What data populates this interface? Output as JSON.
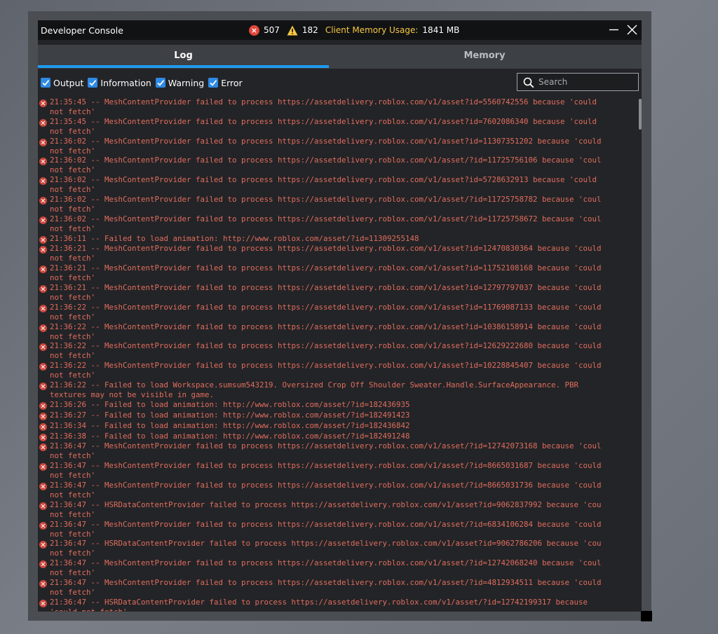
{
  "window": {
    "title": "Developer Console",
    "error_count": "507",
    "warning_count": "182",
    "memory_label": "Client Memory Usage:",
    "memory_value": "1841 MB"
  },
  "tabs": [
    {
      "label": "Log",
      "active": true
    },
    {
      "label": "Memory",
      "active": false
    }
  ],
  "filters": [
    {
      "label": "Output",
      "checked": true
    },
    {
      "label": "Information",
      "checked": true
    },
    {
      "label": "Warning",
      "checked": true
    },
    {
      "label": "Error",
      "checked": true
    }
  ],
  "search": {
    "placeholder": "Search"
  },
  "colors": {
    "error_text": "#e06d5e",
    "accent": "#1e9bf0",
    "memory_label": "#f5c842"
  },
  "log": [
    {
      "line1": "21:35:45 -- MeshContentProvider failed to process https://assetdelivery.roblox.com/v1/asset?id=5560742556 because 'could",
      "line2": "not fetch'"
    },
    {
      "line1": "21:35:45 -- MeshContentProvider failed to process https://assetdelivery.roblox.com/v1/asset?id=7602086340 because 'could",
      "line2": "not fetch'"
    },
    {
      "line1": "21:36:02 -- MeshContentProvider failed to process https://assetdelivery.roblox.com/v1/asset?id=11307351202 because 'could",
      "line2": "not fetch'"
    },
    {
      "line1": "21:36:02 -- MeshContentProvider failed to process https://assetdelivery.roblox.com/v1/asset/?id=11725756106 because 'coul",
      "line2": "not fetch'"
    },
    {
      "line1": "21:36:02 -- MeshContentProvider failed to process https://assetdelivery.roblox.com/v1/asset?id=5728632913 because 'could",
      "line2": "not fetch'"
    },
    {
      "line1": "21:36:02 -- MeshContentProvider failed to process https://assetdelivery.roblox.com/v1/asset/?id=11725758782 because 'coul",
      "line2": "not fetch'"
    },
    {
      "line1": "21:36:02 -- MeshContentProvider failed to process https://assetdelivery.roblox.com/v1/asset/?id=11725758672 because 'coul",
      "line2": "not fetch'"
    },
    {
      "line1": "21:36:11 -- Failed to load animation: http://www.roblox.com/asset/?id=11309255148"
    },
    {
      "line1": "21:36:21 -- MeshContentProvider failed to process https://assetdelivery.roblox.com/v1/asset?id=12470830364 because 'could",
      "line2": "not fetch'"
    },
    {
      "line1": "21:36:21 -- MeshContentProvider failed to process https://assetdelivery.roblox.com/v1/asset?id=11752108168 because 'could",
      "line2": "not fetch'"
    },
    {
      "line1": "21:36:21 -- MeshContentProvider failed to process https://assetdelivery.roblox.com/v1/asset?id=12797797037 because 'could",
      "line2": "not fetch'"
    },
    {
      "line1": "21:36:22 -- MeshContentProvider failed to process https://assetdelivery.roblox.com/v1/asset?id=11769087133 because 'could",
      "line2": "not fetch'"
    },
    {
      "line1": "21:36:22 -- MeshContentProvider failed to process https://assetdelivery.roblox.com/v1/asset?id=10386158914 because 'could",
      "line2": "not fetch'"
    },
    {
      "line1": "21:36:22 -- MeshContentProvider failed to process https://assetdelivery.roblox.com/v1/asset?id=12629222680 because 'could",
      "line2": "not fetch'"
    },
    {
      "line1": "21:36:22 -- MeshContentProvider failed to process https://assetdelivery.roblox.com/v1/asset?id=10228845407 because 'could",
      "line2": "not fetch'"
    },
    {
      "line1": "21:36:22 -- Failed to load Workspace.sumsum543219. Oversized Crop Off Shoulder Sweater.Handle.SurfaceAppearance. PBR",
      "line2": "textures may not be visible in game."
    },
    {
      "line1": "21:36:26 -- Failed to load animation: http://www.roblox.com/asset/?id=182436935"
    },
    {
      "line1": "21:36:27 -- Failed to load animation: http://www.roblox.com/asset/?id=182491423"
    },
    {
      "line1": "21:36:34 -- Failed to load animation: http://www.roblox.com/asset/?id=182436842"
    },
    {
      "line1": "21:36:38 -- Failed to load animation: http://www.roblox.com/asset/?id=182491248"
    },
    {
      "line1": "21:36:47 -- MeshContentProvider failed to process https://assetdelivery.roblox.com/v1/asset/?id=12742073168 because 'coul",
      "line2": "not fetch'"
    },
    {
      "line1": "21:36:47 -- MeshContentProvider failed to process https://assetdelivery.roblox.com/v1/asset/?id=8665031687 because 'could",
      "line2": "not fetch'"
    },
    {
      "line1": "21:36:47 -- MeshContentProvider failed to process https://assetdelivery.roblox.com/v1/asset/?id=8665031736 because 'could",
      "line2": "not fetch'"
    },
    {
      "line1": "21:36:47 -- HSRDataContentProvider failed to process https://assetdelivery.roblox.com/v1/asset?id=9062837992 because 'cou",
      "line2": "not fetch'"
    },
    {
      "line1": "21:36:47 -- MeshContentProvider failed to process https://assetdelivery.roblox.com/v1/asset/?id=6834106284 because 'could",
      "line2": "not fetch'"
    },
    {
      "line1": "21:36:47 -- HSRDataContentProvider failed to process https://assetdelivery.roblox.com/v1/asset?id=9062786206 because 'cou",
      "line2": "not fetch'"
    },
    {
      "line1": "21:36:47 -- MeshContentProvider failed to process https://assetdelivery.roblox.com/v1/asset/?id=12742068240 because 'coul",
      "line2": "not fetch'"
    },
    {
      "line1": "21:36:47 -- MeshContentProvider failed to process https://assetdelivery.roblox.com/v1/asset/?id=4812934511 because 'could",
      "line2": "not fetch'"
    },
    {
      "line1": "21:36:47 -- HSRDataContentProvider failed to process https://assetdelivery.roblox.com/v1/asset/?id=12742199317 because",
      "line2": "'could not fetch'"
    }
  ]
}
